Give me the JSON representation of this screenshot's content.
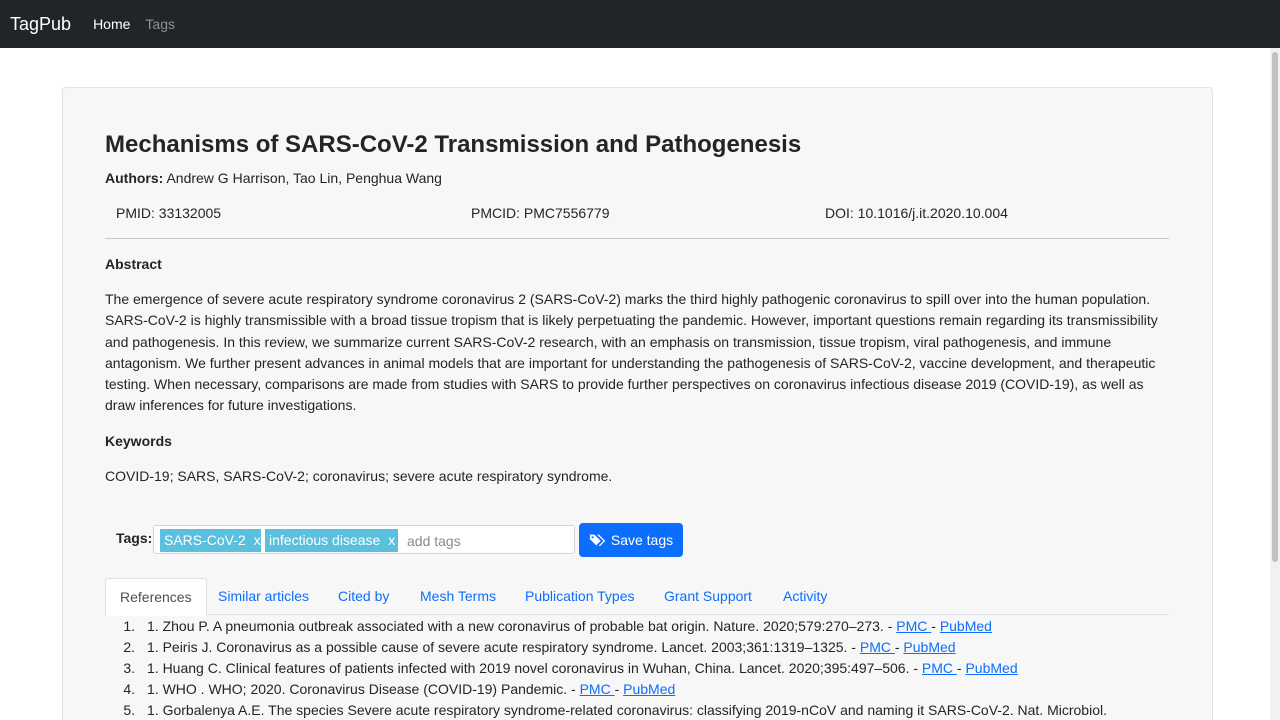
{
  "navbar": {
    "brand": "TagPub",
    "links": [
      "Home",
      "Tags"
    ]
  },
  "article": {
    "title": "Mechanisms of SARS-CoV-2 Transmission and Pathogenesis",
    "authors_label": "Authors:",
    "authors": "Andrew G Harrison, Tao Lin, Penghua Wang",
    "pmid": "PMID: 33132005",
    "pmcid": "PMCID: PMC7556779",
    "doi": "DOI: 10.1016/j.it.2020.10.004",
    "abstract_heading": "Abstract",
    "abstract": "The emergence of severe acute respiratory syndrome coronavirus 2 (SARS-CoV-2) marks the third highly pathogenic coronavirus to spill over into the human population. SARS-CoV-2 is highly transmissible with a broad tissue tropism that is likely perpetuating the pandemic. However, important questions remain regarding its transmissibility and pathogenesis. In this review, we summarize current SARS-CoV-2 research, with an emphasis on transmission, tissue tropism, viral pathogenesis, and immune antagonism. We further present advances in animal models that are important for understanding the pathogenesis of SARS-CoV-2, vaccine development, and therapeutic testing. When necessary, comparisons are made from studies with SARS to provide further perspectives on coronavirus infectious disease 2019 (COVID-19), as well as draw inferences for future investigations.",
    "keywords_heading": "Keywords",
    "keywords": "COVID-19; SARS, SARS-CoV-2; coronavirus; severe acute respiratory syndrome."
  },
  "tags": {
    "label": "Tags:",
    "items": [
      "SARS-CoV-2",
      "infectious disease"
    ],
    "remove_glyph": "x",
    "input_placeholder": "add tags",
    "save_label": "Save tags"
  },
  "tabs": [
    "References",
    "Similar articles",
    "Cited by",
    "Mesh Terms",
    "Publication Types",
    "Grant Support",
    "Activity"
  ],
  "references": [
    {
      "num": "1.",
      "text": "1. Zhou P. A pneumonia outbreak associated with a new coronavirus of probable bat origin. Nature. 2020;579:270–273. - ",
      "pmc": "PMC ",
      "sep": " - ",
      "pubmed": "PubMed"
    },
    {
      "num": "2.",
      "text": "1. Peiris J. Coronavirus as a possible cause of severe acute respiratory syndrome. Lancet. 2003;361:1319–1325. - ",
      "pmc": "PMC ",
      "sep": " - ",
      "pubmed": "PubMed"
    },
    {
      "num": "3.",
      "text": "1. Huang C. Clinical features of patients infected with 2019 novel coronavirus in Wuhan, China. Lancet. 2020;395:497–506. - ",
      "pmc": "PMC ",
      "sep": " - ",
      "pubmed": "PubMed"
    },
    {
      "num": "4.",
      "text": "1. WHO . WHO; 2020. Coronavirus Disease (COVID-19) Pandemic. - ",
      "pmc": "PMC ",
      "sep": " - ",
      "pubmed": "PubMed"
    },
    {
      "num": "5.",
      "text": "1. Gorbalenya A.E. The species Severe acute respiratory syndrome-related coronavirus: classifying 2019-nCoV and naming it SARS-CoV-2. Nat. Microbiol.",
      "pmc": "",
      "sep": "",
      "pubmed": ""
    }
  ]
}
